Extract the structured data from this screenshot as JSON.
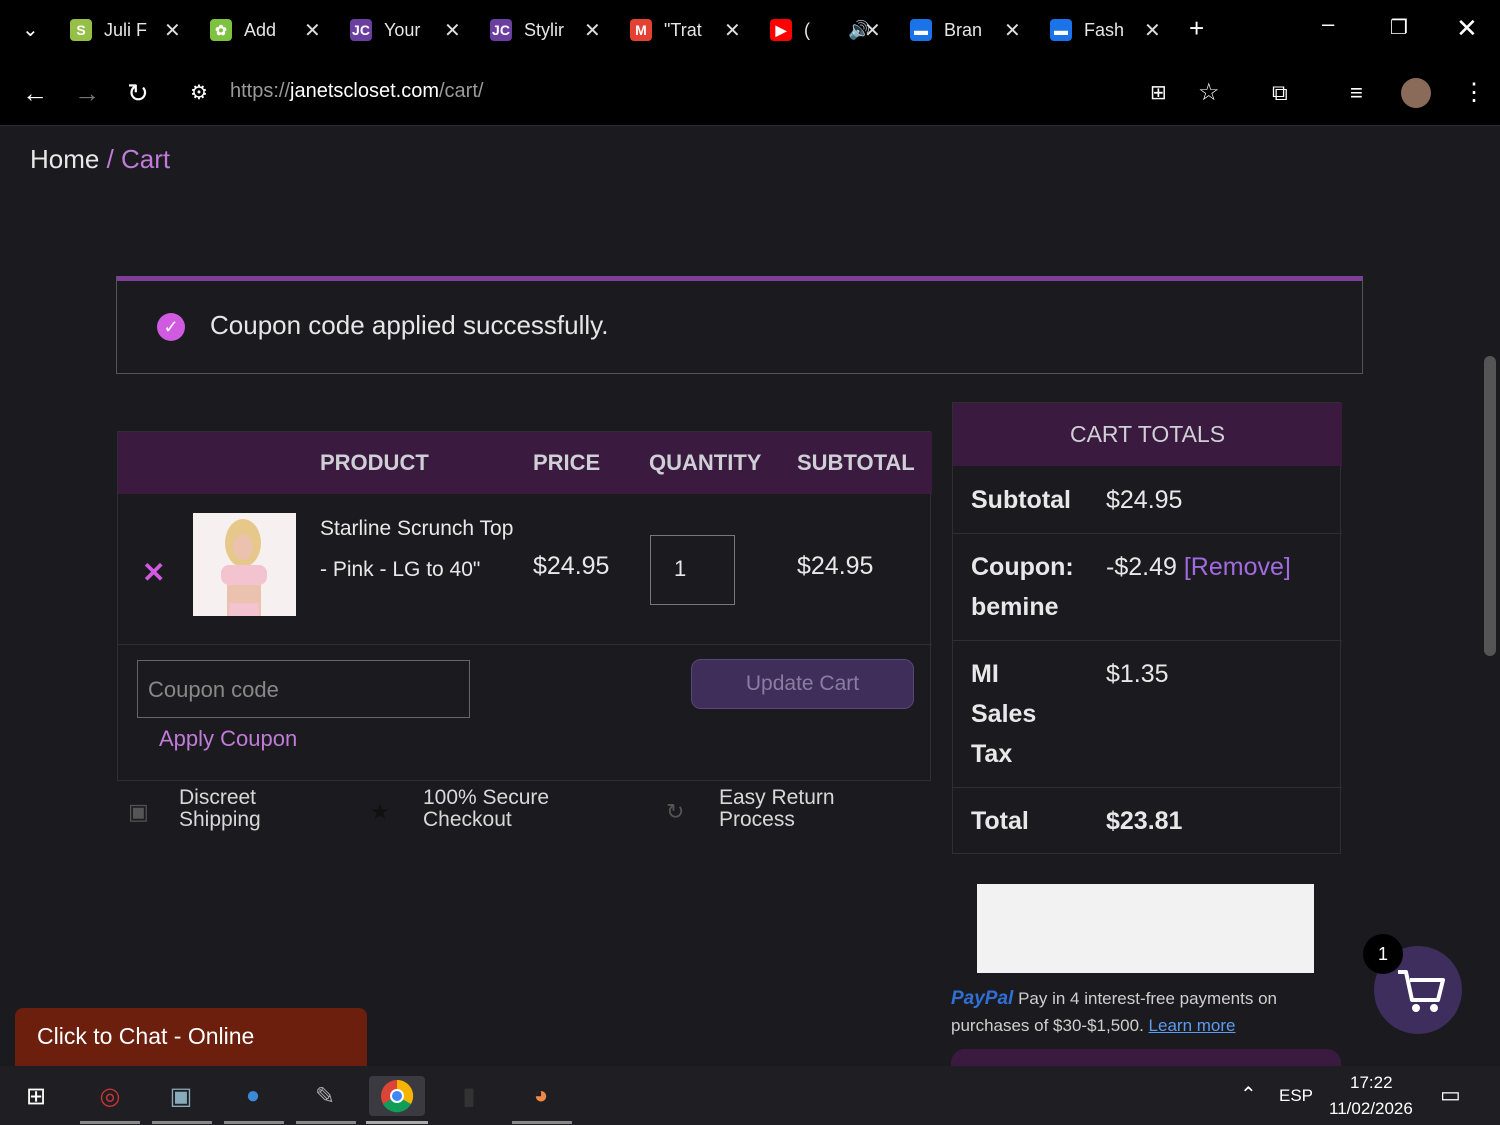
{
  "browser": {
    "tabs": [
      {
        "label": "Juli F",
        "icon": "shopify-icon",
        "color": "#95bf47"
      },
      {
        "label": "Add",
        "icon": "cog-icon",
        "color": "#7fc241"
      },
      {
        "label": "Your",
        "icon": "jc-logo-icon",
        "color": "#6b3fa0"
      },
      {
        "label": "Stylir",
        "icon": "jc-logo-icon",
        "color": "#6b3fa0"
      },
      {
        "label": "\"Trat",
        "icon": "gmail-icon",
        "color": "#e44134"
      },
      {
        "label": "(",
        "icon": "youtube-icon",
        "color": "#ff0000"
      },
      {
        "label": "Bran",
        "icon": "chat-icon",
        "color": "#1a73e8"
      },
      {
        "label": "Fash",
        "icon": "chat-icon",
        "color": "#1a73e8"
      }
    ],
    "url_scheme": "https://",
    "url_host": "janetscloset.com",
    "url_path": "/cart/"
  },
  "breadcrumb": {
    "home": "Home",
    "sep": " / ",
    "current": "Cart"
  },
  "notice": "Coupon code applied successfully.",
  "cart": {
    "headers": {
      "product": "PRODUCT",
      "price": "PRICE",
      "quantity": "QUANTITY",
      "subtotal": "SUBTOTAL"
    },
    "item": {
      "name": "Starline Scrunch Top - Pink - LG to 40\"",
      "price": "$24.95",
      "quantity": "1",
      "subtotal": "$24.95"
    },
    "coupon_placeholder": "Coupon code",
    "apply_label": "Apply Coupon",
    "update_label": "Update Cart"
  },
  "features": [
    {
      "label": "Discreet Shipping",
      "icon": "box-icon"
    },
    {
      "label": "100% Secure Checkout",
      "icon": "star-icon"
    },
    {
      "label": "Easy Return Process",
      "icon": "refresh-icon"
    }
  ],
  "totals": {
    "title": "CART TOTALS",
    "subtotal_label": "Subtotal",
    "subtotal": "$24.95",
    "coupon_label": "Coupon: bemine",
    "coupon": "-$2.49",
    "remove": "[Remove]",
    "tax_label": "MI Sales Tax",
    "tax": "$1.35",
    "total_label": "Total",
    "total": "$23.81"
  },
  "paypal": {
    "logo": "PayPal",
    "text": "Pay in 4 interest-free payments on purchases of $30-$1,500.",
    "link": "Learn more"
  },
  "chat": "Click to Chat - Online",
  "cart_count": "1",
  "taskbar": {
    "lang": "ESP",
    "time": "17:22",
    "date": "11/02/2026"
  },
  "colors": {
    "accent": "#7d3f98",
    "header_bg": "#3a1a3e",
    "link": "#c07ad8",
    "chat_bg": "#6b1f0c"
  }
}
